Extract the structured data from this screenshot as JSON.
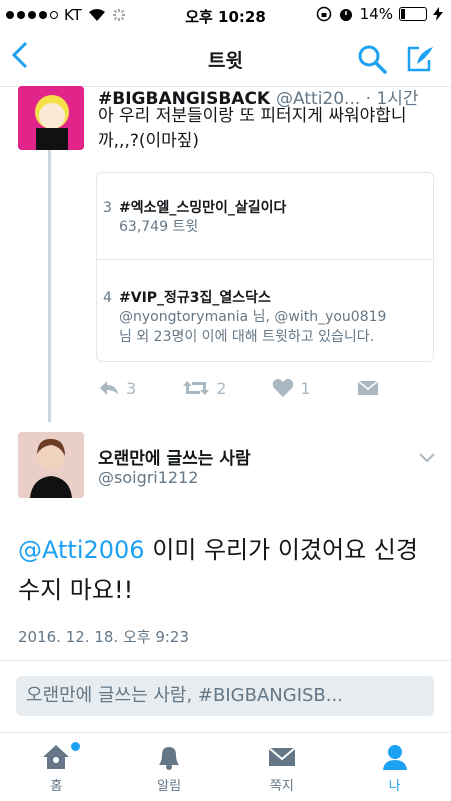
{
  "status_bar": {
    "carrier": "KT",
    "time": "오후 10:28",
    "battery": "14%"
  },
  "nav": {
    "title": "트윗"
  },
  "tweet1": {
    "name": "#BIGBANGISBACK",
    "handle": "@Atti20... · 1시간",
    "text": "아 우리 저분들이랑 또 피터지게 싸워야합니까,,,?(이마짚)",
    "trends": [
      {
        "rank": "3",
        "tag": "#엑소엘_스밍만이_살길이다",
        "line1": "63,749 트윗",
        "line2": ""
      },
      {
        "rank": "4",
        "tag": "#VIP_정규3집_열스닥스",
        "line1": "@nyongtorymania 님, @with_you0819",
        "line2": "님 외 23명이 이에 대해 트윗하고 있습니다."
      }
    ],
    "actions": {
      "replies": "3",
      "retweets": "2",
      "likes": "1"
    }
  },
  "tweet2": {
    "name": "오랜만에 글쓰는 사람",
    "handle": "@soigri1212",
    "mention": "@Atti2006",
    "text": " 이미 우리가 이겼어요 신경수지 마요!!",
    "timestamp": "2016. 12. 18. 오후 9:23"
  },
  "reply_box": {
    "placeholder": "오랜만에 글쓰는 사람, #BIGBANGISB..."
  },
  "tabs": [
    {
      "label": "홈",
      "icon": "home-icon"
    },
    {
      "label": "알림",
      "icon": "bell-icon"
    },
    {
      "label": "쪽지",
      "icon": "envelope-icon"
    },
    {
      "label": "나",
      "icon": "person-icon"
    }
  ],
  "colors": {
    "accent": "#1da1f2",
    "text": "#14171a",
    "muted": "#657786"
  }
}
